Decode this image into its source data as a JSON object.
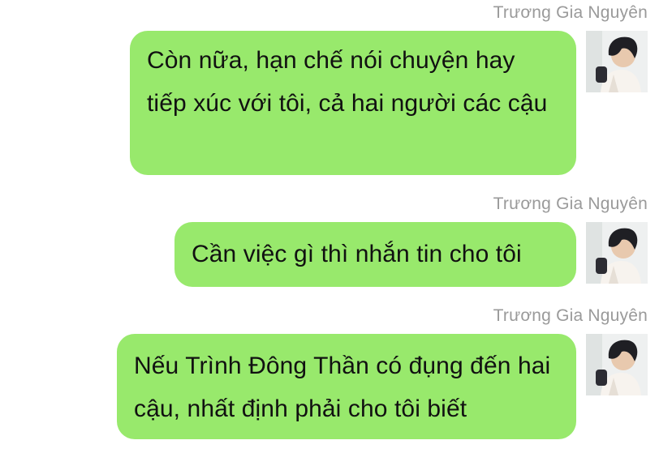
{
  "messages": [
    {
      "sender": "Trương Gia Nguyên",
      "text": "Còn nữa, hạn chế nói chuyện hay tiếp xúc với tôi, cả hai người các cậu",
      "avatar_icon": "user-avatar-photo"
    },
    {
      "sender": "Trương Gia Nguyên",
      "text": "Cần việc gì thì nhắn tin cho tôi",
      "avatar_icon": "user-avatar-photo"
    },
    {
      "sender": "Trương Gia Nguyên",
      "text": "Nếu Trình Đông Thần có đụng đến hai cậu, nhất định phải cho tôi biết",
      "avatar_icon": "user-avatar-photo"
    }
  ],
  "colors": {
    "bubble": "#98e96c",
    "sender_name": "#9a9a9a",
    "text": "#111111"
  }
}
